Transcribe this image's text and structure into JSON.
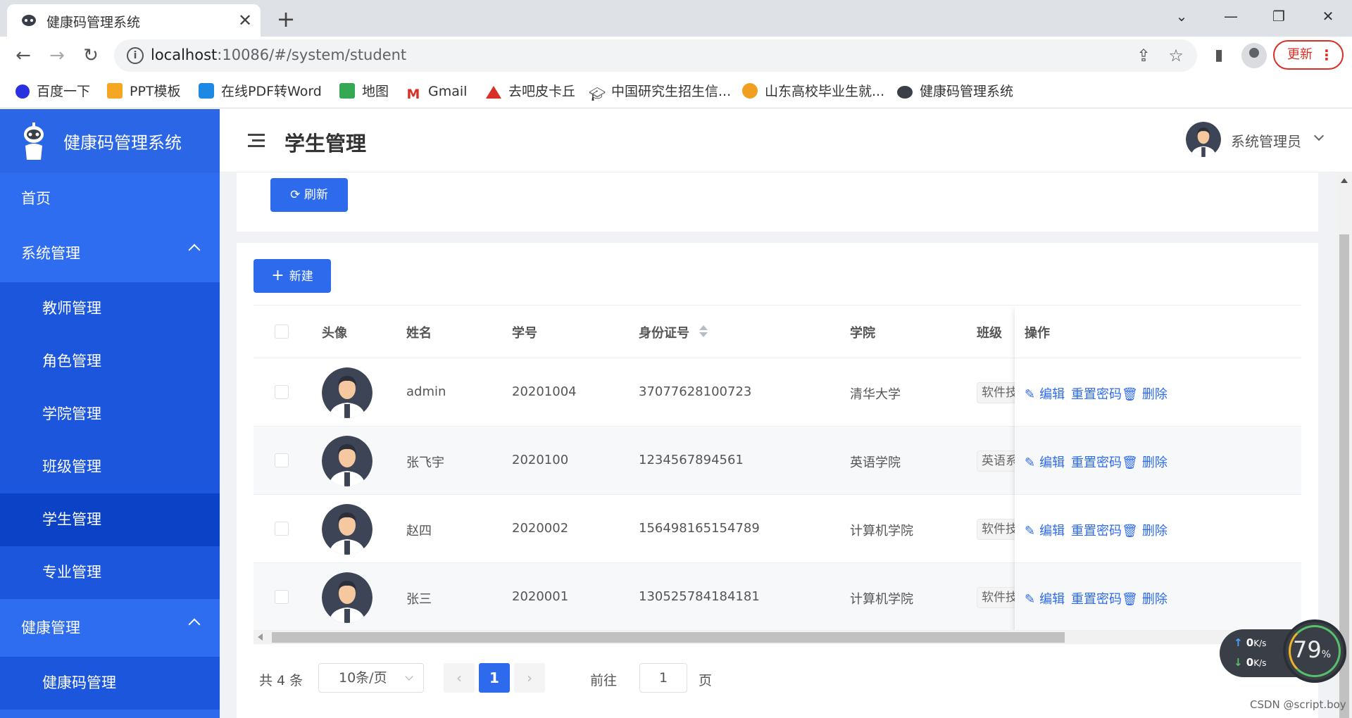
{
  "browser": {
    "tab_title": "健康码管理系统",
    "url_host": "localhost",
    "url_path": ":10086/#/system/student",
    "update_label": "更新",
    "bookmarks": [
      "百度一下",
      "PPT模板",
      "在线PDF转Word",
      "地图",
      "Gmail",
      "去吧皮卡丘",
      "中国研究生招生信...",
      "山东高校毕业生就...",
      "健康码管理系统"
    ]
  },
  "app": {
    "name": "健康码管理系统",
    "page_title": "学生管理",
    "user_name": "系统管理员",
    "accent": "#2d6bec"
  },
  "sidebar": {
    "home": "首页",
    "system": "系统管理",
    "system_items": [
      "教师管理",
      "角色管理",
      "学院管理",
      "班级管理",
      "学生管理",
      "专业管理"
    ],
    "active_item": "学生管理",
    "health": "健康管理",
    "health_items": [
      "健康码管理"
    ]
  },
  "toolbar": {
    "refresh_label": "刷新",
    "new_label": "新建"
  },
  "table": {
    "headers": {
      "avatar": "头像",
      "name": "姓名",
      "student_no": "学号",
      "id_card": "身份证号",
      "college": "学院",
      "class": "班级",
      "ops": "操作"
    },
    "rows": [
      {
        "name": "admin",
        "student_no": "20201004",
        "id_card": "37077628100723",
        "college": "清华大学",
        "class": "软件技"
      },
      {
        "name": "张飞宇",
        "student_no": "2020100",
        "id_card": "1234567894561",
        "college": "英语学院",
        "class": "英语系"
      },
      {
        "name": "赵四",
        "student_no": "2020002",
        "id_card": "156498165154789",
        "college": "计算机学院",
        "class": "软件技"
      },
      {
        "name": "张三",
        "student_no": "2020001",
        "id_card": "130525784184181",
        "college": "计算机学院",
        "class": "软件技"
      }
    ],
    "ops": {
      "edit": "编辑",
      "reset_pwd": "重置密码",
      "delete": "删除"
    }
  },
  "pager": {
    "total": "共 4 条",
    "page_size": "10条/页",
    "current": "1",
    "goto_label": "前往",
    "goto_value": "1",
    "page_unit": "页"
  },
  "overlay": {
    "upload": "0",
    "download": "0",
    "rate_unit": "K/s",
    "percent": "79",
    "percent_unit": "%",
    "watermark": "CSDN @script.boy"
  }
}
